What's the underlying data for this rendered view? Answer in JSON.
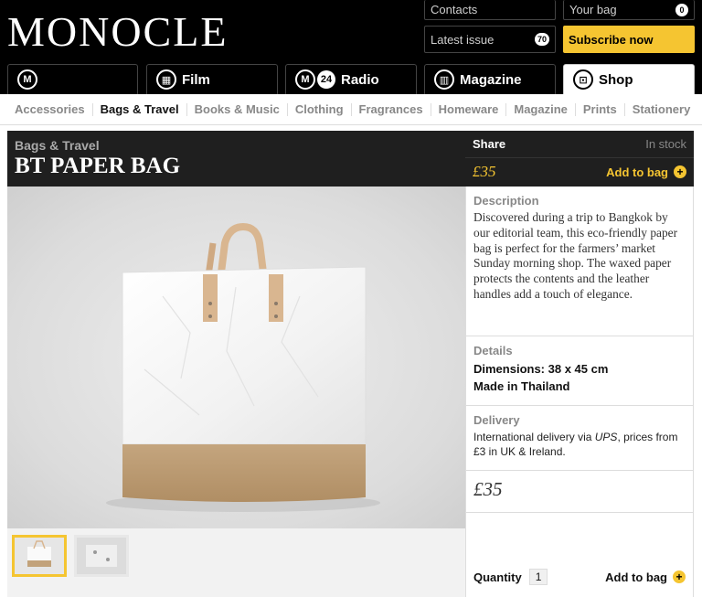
{
  "header": {
    "logo": "MONOCLE",
    "contacts_label": "Contacts",
    "latest_issue_label": "Latest issue",
    "latest_issue_count": "70",
    "bag_label": "Your bag",
    "bag_count": "0",
    "subscribe_label": "Subscribe now"
  },
  "main_nav": {
    "film": "Film",
    "radio_badge": "24",
    "radio": "Radio",
    "magazine": "Magazine",
    "shop": "Shop"
  },
  "sub_nav": [
    "Accessories",
    "Bags & Travel",
    "Books & Music",
    "Clothing",
    "Fragrances",
    "Homeware",
    "Magazine",
    "Prints",
    "Stationery"
  ],
  "product": {
    "category": "Bags & Travel",
    "title": "BT PAPER BAG",
    "share_label": "Share",
    "stock_status": "In stock",
    "price": "£35",
    "add_to_bag": "Add to bag",
    "description_heading": "Description",
    "description": "Discovered during a trip to Bangkok by our editorial team, this eco-friendly paper bag is perfect for the farmers’ market Sunday morning shop. The waxed paper protects the contents and the leather handles add a touch of elegance.",
    "details_heading": "Details",
    "dimensions": "Dimensions: 38 x 45 cm",
    "origin": "Made in Thailand",
    "delivery_heading": "Delivery",
    "delivery_pre": "International delivery via ",
    "delivery_carrier": "UPS",
    "delivery_post": ", prices from £3 in UK & Ireland.",
    "price_large": "£35",
    "quantity_label": "Quantity",
    "quantity_value": "1"
  },
  "colors": {
    "accent": "#f5c531",
    "header_bg": "#000000",
    "panel_bg": "#1f1f1f"
  }
}
